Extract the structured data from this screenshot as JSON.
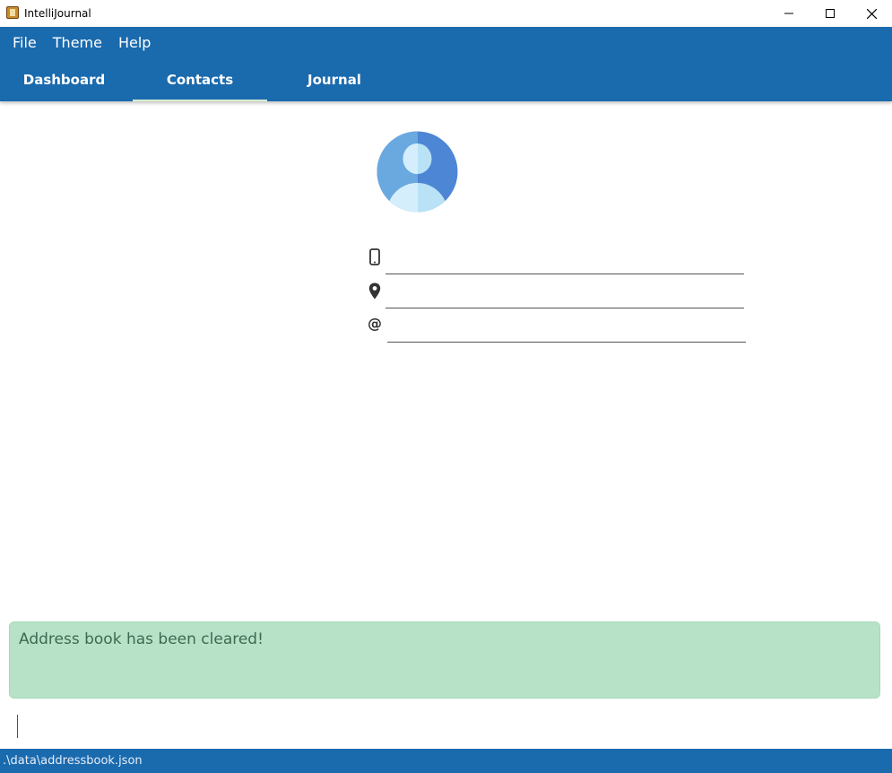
{
  "window": {
    "title": "IntelliJournal",
    "icon": "app-icon"
  },
  "menu": {
    "items": [
      {
        "label": "File"
      },
      {
        "label": "Theme"
      },
      {
        "label": "Help"
      }
    ]
  },
  "tabs": [
    {
      "label": "Dashboard",
      "active": false
    },
    {
      "label": "Contacts",
      "active": true
    },
    {
      "label": "Journal",
      "active": false
    }
  ],
  "contact": {
    "avatar_icon": "user-avatar-icon",
    "phone": "",
    "address": "",
    "email": "",
    "phone_icon": "mobile-phone-icon",
    "address_icon": "map-pin-icon",
    "email_icon": "at-sign-icon"
  },
  "result": {
    "message": "Address book has been cleared!"
  },
  "command": {
    "value": ""
  },
  "status": {
    "file_path": ".\\data\\addressbook.json"
  },
  "colors": {
    "primary": "#1a6aae",
    "result_bg": "#b8e2c8",
    "result_text": "#3b6a52",
    "tab_indicator": "#d8efd0"
  }
}
